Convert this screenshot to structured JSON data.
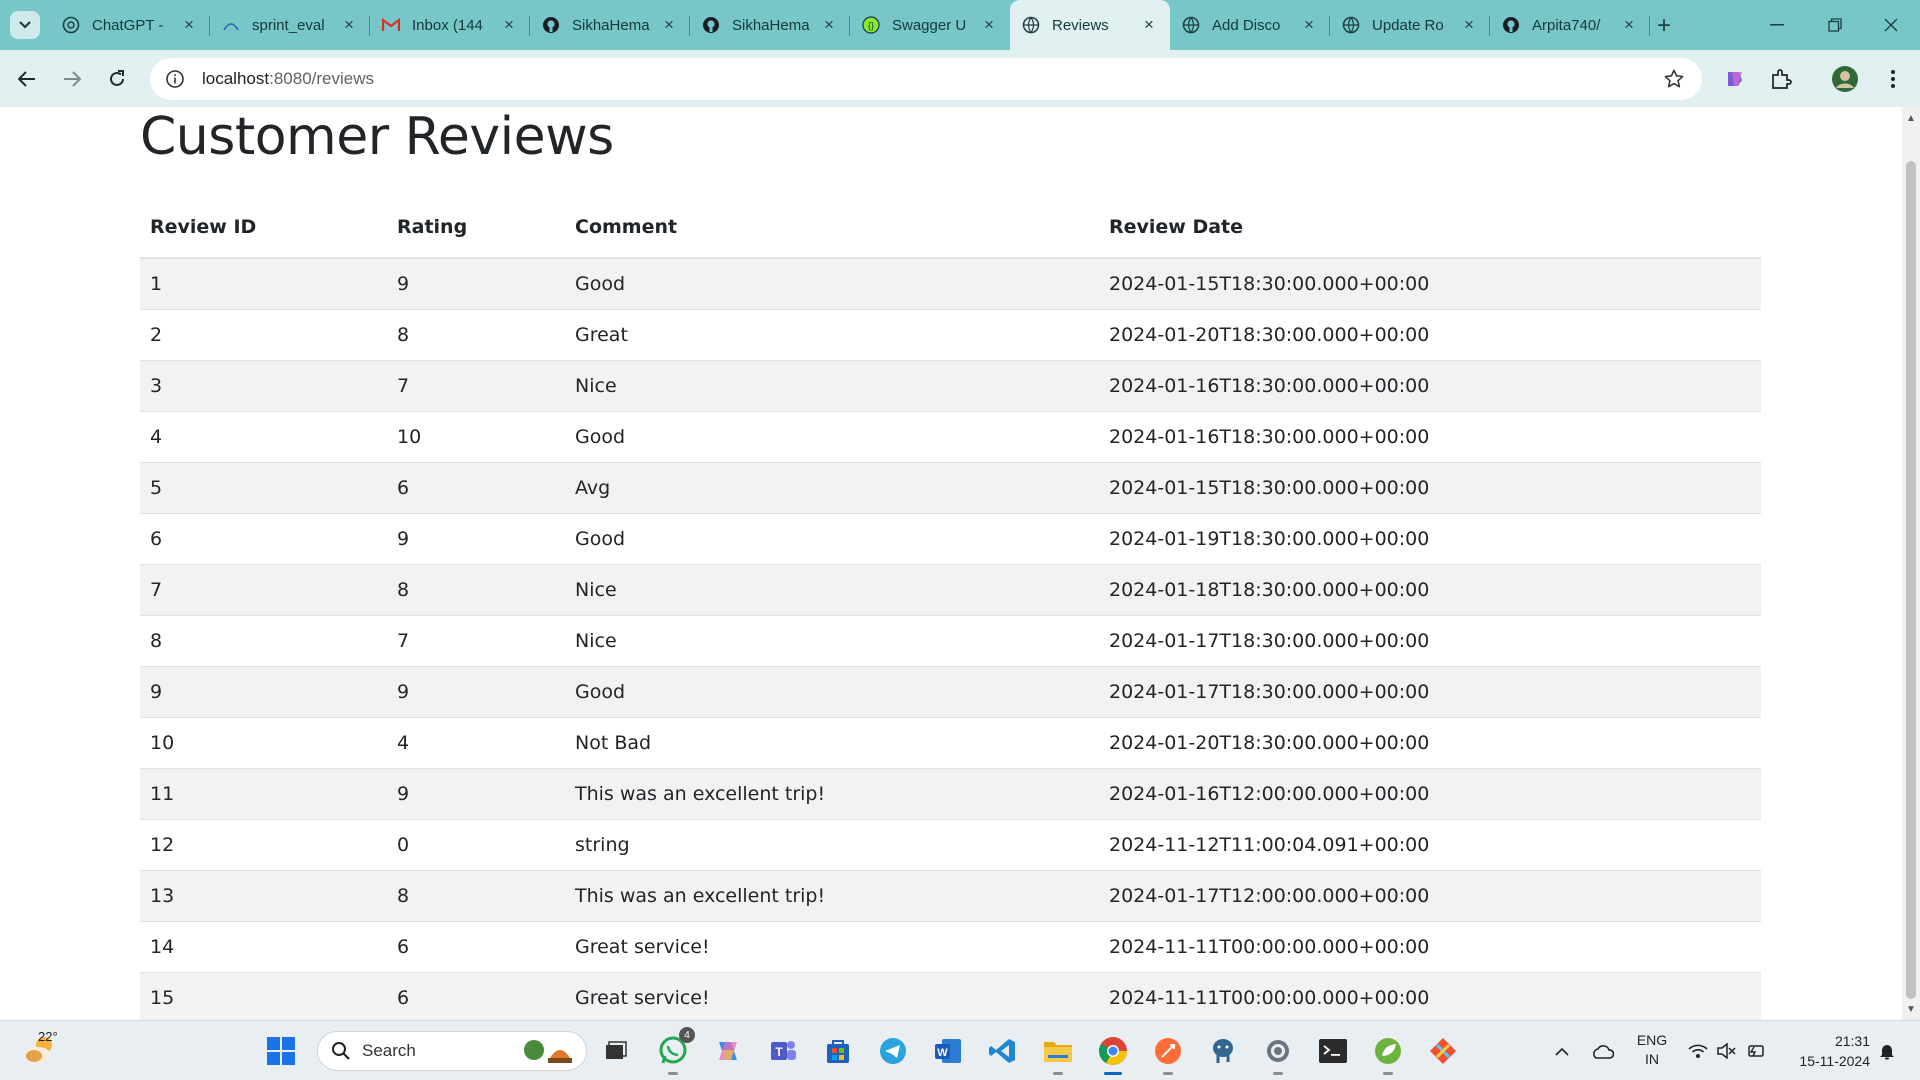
{
  "browser": {
    "tabs": [
      {
        "title": "ChatGPT -",
        "icon": "chatgpt-icon",
        "active": false
      },
      {
        "title": "sprint_eval",
        "icon": "sprint-icon",
        "active": false
      },
      {
        "title": "Inbox (144",
        "icon": "gmail-icon",
        "active": false
      },
      {
        "title": "SikhaHema",
        "icon": "github-icon",
        "active": false
      },
      {
        "title": "SikhaHema",
        "icon": "github-icon",
        "active": false
      },
      {
        "title": "Swagger U",
        "icon": "swagger-icon",
        "active": false
      },
      {
        "title": "Reviews",
        "icon": "globe-icon",
        "active": true
      },
      {
        "title": "Add Disco",
        "icon": "globe-icon",
        "active": false
      },
      {
        "title": "Update Ro",
        "icon": "globe-icon",
        "active": false
      },
      {
        "title": "Arpita740/",
        "icon": "github-icon",
        "active": false
      }
    ],
    "url_host": "localhost",
    "url_path": ":8080/reviews"
  },
  "page": {
    "title": "Customer Reviews",
    "columns": [
      "Review ID",
      "Rating",
      "Comment",
      "Review Date"
    ],
    "rows": [
      {
        "id": "1",
        "rating": "9",
        "comment": "Good",
        "date": "2024-01-15T18:30:00.000+00:00"
      },
      {
        "id": "2",
        "rating": "8",
        "comment": "Great",
        "date": "2024-01-20T18:30:00.000+00:00"
      },
      {
        "id": "3",
        "rating": "7",
        "comment": "Nice",
        "date": "2024-01-16T18:30:00.000+00:00"
      },
      {
        "id": "4",
        "rating": "10",
        "comment": "Good",
        "date": "2024-01-16T18:30:00.000+00:00"
      },
      {
        "id": "5",
        "rating": "6",
        "comment": "Avg",
        "date": "2024-01-15T18:30:00.000+00:00"
      },
      {
        "id": "6",
        "rating": "9",
        "comment": "Good",
        "date": "2024-01-19T18:30:00.000+00:00"
      },
      {
        "id": "7",
        "rating": "8",
        "comment": "Nice",
        "date": "2024-01-18T18:30:00.000+00:00"
      },
      {
        "id": "8",
        "rating": "7",
        "comment": "Nice",
        "date": "2024-01-17T18:30:00.000+00:00"
      },
      {
        "id": "9",
        "rating": "9",
        "comment": "Good",
        "date": "2024-01-17T18:30:00.000+00:00"
      },
      {
        "id": "10",
        "rating": "4",
        "comment": "Not Bad",
        "date": "2024-01-20T18:30:00.000+00:00"
      },
      {
        "id": "11",
        "rating": "9",
        "comment": "This was an excellent trip!",
        "date": "2024-01-16T12:00:00.000+00:00"
      },
      {
        "id": "12",
        "rating": "0",
        "comment": "string",
        "date": "2024-11-12T11:00:04.091+00:00"
      },
      {
        "id": "13",
        "rating": "8",
        "comment": "This was an excellent trip!",
        "date": "2024-01-17T12:00:00.000+00:00"
      },
      {
        "id": "14",
        "rating": "6",
        "comment": "Great service!",
        "date": "2024-11-11T00:00:00.000+00:00"
      },
      {
        "id": "15",
        "rating": "6",
        "comment": "Great service!",
        "date": "2024-11-11T00:00:00.000+00:00"
      }
    ]
  },
  "taskbar": {
    "weather_temp": "22°",
    "search_label": "Search",
    "whatsapp_badge": "4",
    "lang_line1": "ENG",
    "lang_line2": "IN",
    "time": "21:31",
    "date": "15-11-2024",
    "apps": [
      "whatsapp-icon",
      "copilot-icon",
      "teams-icon",
      "store-icon",
      "telegram-icon",
      "word-icon",
      "vscode-icon",
      "file-explorer-icon",
      "chrome-icon",
      "postman-icon",
      "postgres-icon",
      "settings-icon",
      "terminal-icon",
      "spring-icon",
      "git-icon"
    ]
  },
  "colors": {
    "tabstrip": "#77c6c8",
    "toolbar": "#e1f1f1",
    "stripe": "#f2f2f2"
  }
}
